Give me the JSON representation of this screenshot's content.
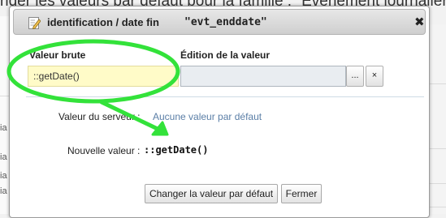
{
  "background": {
    "title": "nder les valeurs par défaut pour la famille : \"Événement journalier",
    "left_row_letters": [
      "ia",
      "ia",
      "ia",
      "ia"
    ]
  },
  "dialog": {
    "title": "identification / date fin",
    "title_code": "\"evt_enddate\"",
    "close_symbol": "✖",
    "raw_label": "Valeur brute",
    "edit_label": "Édition de la valeur",
    "raw_value": "::getDate()",
    "edit_value": "",
    "browse_button": "...",
    "clear_button": "×",
    "server_label": "Valeur du serveur :",
    "server_value": "Aucune valeur par défaut",
    "new_label": "Nouvelle valeur :",
    "new_value": "::getDate()",
    "change_button": "Changer la valeur par défaut",
    "close_button": "Fermer"
  },
  "annotation": {
    "color": "#33e23a",
    "shape": "ellipse-with-arrow"
  },
  "icons": {
    "title_icon": "edit-pencil-icon"
  }
}
